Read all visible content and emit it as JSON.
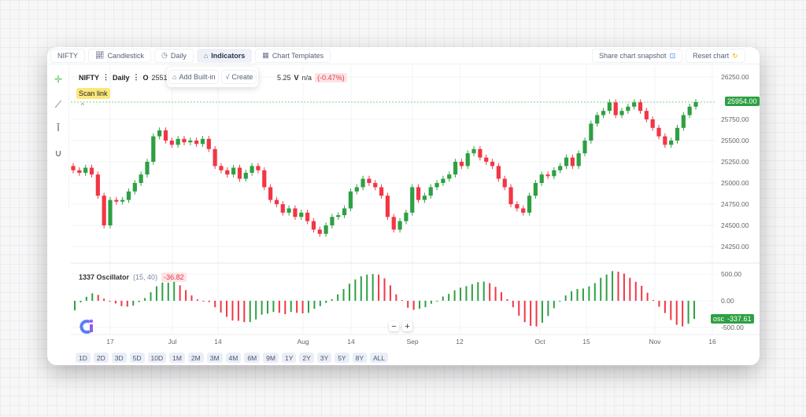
{
  "toolbar": {
    "symbol": "NIFTY",
    "chart_type": "Candlestick",
    "interval": "Daily",
    "indicators": "Indicators",
    "templates": "Chart Templates",
    "share": "Share chart snapshot",
    "reset": "Reset chart"
  },
  "indicator_menu": {
    "add_builtin": "Add Built-in",
    "create": "Create"
  },
  "legend": {
    "symbol": "NIFTY",
    "interval": "Daily",
    "open_label": "O",
    "open": "25511.65",
    "partial": "5.25",
    "volume_label": "V",
    "volume": "n/a",
    "change": "(-0.47%)"
  },
  "scan_link": "Scan link",
  "oscillator": {
    "name": "1337 Oscillator",
    "params": "(15, 40)",
    "value": "-36.82",
    "tag_label": "osc",
    "last_value": "-337.61"
  },
  "price_tag": "25954.00",
  "colors": {
    "up": "#2ea043",
    "down": "#f23645",
    "accent": "#2ea043"
  },
  "zoom": {
    "minus": "−",
    "plus": "+"
  },
  "ranges": [
    "1D",
    "2D",
    "3D",
    "5D",
    "10D",
    "1M",
    "2M",
    "3M",
    "4M",
    "6M",
    "9M",
    "1Y",
    "2Y",
    "3Y",
    "5Y",
    "8Y",
    "ALL"
  ],
  "chart_data": [
    {
      "type": "candlestick",
      "y_ticks": [
        "26250.00",
        "25750.00",
        "25500.00",
        "25250.00",
        "25000.00",
        "24750.00",
        "24500.00",
        "24250.00"
      ],
      "ylim": [
        24200,
        26300
      ],
      "x_ticks": [
        "17",
        "Jul",
        "14",
        "Aug",
        "14",
        "Sep",
        "12",
        "Oct",
        "15",
        "Nov",
        "16"
      ],
      "last_price": 25954.0,
      "candles": [
        [
          25200,
          25235,
          25115,
          25150
        ],
        [
          25150,
          25185,
          25085,
          25120
        ],
        [
          25120,
          25215,
          25085,
          25180
        ],
        [
          25180,
          25215,
          25065,
          25100
        ],
        [
          25100,
          25135,
          24815,
          24850
        ],
        [
          24850,
          24885,
          24465,
          24500
        ],
        [
          24500,
          24835,
          24465,
          24800
        ],
        [
          24800,
          24835,
          24745,
          24780
        ],
        [
          24780,
          24835,
          24745,
          24800
        ],
        [
          24800,
          24935,
          24765,
          24900
        ],
        [
          24900,
          25035,
          24865,
          25000
        ],
        [
          25000,
          25135,
          24965,
          25100
        ],
        [
          25100,
          25285,
          25065,
          25250
        ],
        [
          25250,
          25585,
          25215,
          25550
        ],
        [
          25550,
          25655,
          25515,
          25620
        ],
        [
          25620,
          25655,
          25465,
          25500
        ],
        [
          25500,
          25535,
          25415,
          25450
        ],
        [
          25450,
          25555,
          25415,
          25520
        ],
        [
          25520,
          25555,
          25445,
          25480
        ],
        [
          25480,
          25535,
          25445,
          25500
        ],
        [
          25500,
          25535,
          25425,
          25460
        ],
        [
          25460,
          25555,
          25425,
          25520
        ],
        [
          25520,
          25555,
          25365,
          25400
        ],
        [
          25400,
          25435,
          25165,
          25200
        ],
        [
          25200,
          25235,
          25115,
          25150
        ],
        [
          25150,
          25185,
          25065,
          25100
        ],
        [
          25100,
          25215,
          25065,
          25180
        ],
        [
          25180,
          25215,
          25015,
          25050
        ],
        [
          25050,
          25155,
          25015,
          25120
        ],
        [
          25120,
          25235,
          25085,
          25200
        ],
        [
          25200,
          25235,
          25115,
          25150
        ],
        [
          25150,
          25185,
          24915,
          24950
        ],
        [
          24950,
          24985,
          24765,
          24800
        ],
        [
          24800,
          24835,
          24715,
          24750
        ],
        [
          24750,
          24785,
          24615,
          24650
        ],
        [
          24650,
          24735,
          24615,
          24700
        ],
        [
          24700,
          24735,
          24565,
          24600
        ],
        [
          24600,
          24685,
          24565,
          24650
        ],
        [
          24650,
          24685,
          24515,
          24550
        ],
        [
          24550,
          24585,
          24415,
          24450
        ],
        [
          24450,
          24485,
          24365,
          24400
        ],
        [
          24400,
          24535,
          24365,
          24500
        ],
        [
          24500,
          24635,
          24465,
          24600
        ],
        [
          24600,
          24655,
          24565,
          24620
        ],
        [
          24620,
          24735,
          24585,
          24700
        ],
        [
          24700,
          24935,
          24665,
          24900
        ],
        [
          24900,
          24985,
          24865,
          24950
        ],
        [
          24950,
          25085,
          24915,
          25050
        ],
        [
          25050,
          25085,
          24965,
          25000
        ],
        [
          25000,
          25035,
          24915,
          24950
        ],
        [
          24950,
          24985,
          24815,
          24850
        ],
        [
          24850,
          24885,
          24565,
          24600
        ],
        [
          24600,
          24635,
          24415,
          24450
        ],
        [
          24450,
          24585,
          24415,
          24550
        ],
        [
          24550,
          24685,
          24515,
          24650
        ],
        [
          24650,
          24985,
          24615,
          24950
        ],
        [
          24950,
          24985,
          24765,
          24800
        ],
        [
          24800,
          24885,
          24765,
          24850
        ],
        [
          24850,
          24985,
          24815,
          24950
        ],
        [
          24950,
          25035,
          24915,
          25000
        ],
        [
          25000,
          25085,
          24965,
          25050
        ],
        [
          25050,
          25135,
          25015,
          25100
        ],
        [
          25100,
          25285,
          25065,
          25250
        ],
        [
          25250,
          25285,
          25165,
          25200
        ],
        [
          25200,
          25385,
          25165,
          25350
        ],
        [
          25350,
          25435,
          25315,
          25400
        ],
        [
          25400,
          25435,
          25265,
          25300
        ],
        [
          25300,
          25335,
          25215,
          25250
        ],
        [
          25250,
          25285,
          25165,
          25200
        ],
        [
          25200,
          25235,
          25015,
          25050
        ],
        [
          25050,
          25085,
          24915,
          24950
        ],
        [
          24950,
          24985,
          24715,
          24750
        ],
        [
          24750,
          24785,
          24665,
          24700
        ],
        [
          24700,
          24735,
          24615,
          24650
        ],
        [
          24650,
          24885,
          24615,
          24850
        ],
        [
          24850,
          25035,
          24815,
          25000
        ],
        [
          25000,
          25135,
          24965,
          25100
        ],
        [
          25100,
          25135,
          25045,
          25080
        ],
        [
          25080,
          25185,
          25045,
          25150
        ],
        [
          25150,
          25235,
          25115,
          25200
        ],
        [
          25200,
          25335,
          25165,
          25300
        ],
        [
          25300,
          25335,
          25165,
          25200
        ],
        [
          25200,
          25385,
          25165,
          25350
        ],
        [
          25350,
          25535,
          25315,
          25500
        ],
        [
          25500,
          25735,
          25465,
          25700
        ],
        [
          25700,
          25835,
          25665,
          25800
        ],
        [
          25800,
          25885,
          25765,
          25850
        ],
        [
          25850,
          25985,
          25815,
          25950
        ],
        [
          25950,
          25985,
          25765,
          25800
        ],
        [
          25800,
          25885,
          25765,
          25850
        ],
        [
          25850,
          25935,
          25815,
          25900
        ],
        [
          25900,
          25985,
          25865,
          25950
        ],
        [
          25950,
          25985,
          25815,
          25850
        ],
        [
          25850,
          25885,
          25715,
          25750
        ],
        [
          25750,
          25785,
          25615,
          25650
        ],
        [
          25650,
          25685,
          25515,
          25550
        ],
        [
          25550,
          25585,
          25415,
          25450
        ],
        [
          25450,
          25535,
          25415,
          25500
        ],
        [
          25500,
          25685,
          25465,
          25650
        ],
        [
          25650,
          25835,
          25615,
          25800
        ],
        [
          25800,
          25935,
          25765,
          25900
        ],
        [
          25900,
          25989,
          25865,
          25954
        ]
      ]
    },
    {
      "type": "bar",
      "name": "1337 Oscillator",
      "y_ticks": [
        "500.00",
        "0.00",
        "-500.00"
      ],
      "ylim": [
        -650,
        650
      ],
      "values": [
        -180,
        -30,
        75,
        140,
        110,
        40,
        0,
        -50,
        -100,
        -110,
        -90,
        -25,
        50,
        160,
        270,
        340,
        340,
        360,
        290,
        200,
        100,
        25,
        0,
        -25,
        -120,
        -220,
        -300,
        -370,
        -375,
        -400,
        -400,
        -350,
        -260,
        -240,
        -210,
        -225,
        -250,
        -210,
        -225,
        -235,
        -225,
        -150,
        -100,
        -40,
        30,
        120,
        220,
        320,
        400,
        460,
        490,
        500,
        490,
        420,
        290,
        120,
        15,
        -130,
        -170,
        -150,
        -120,
        -55,
        0,
        80,
        130,
        195,
        245,
        275,
        310,
        350,
        360,
        330,
        260,
        160,
        30,
        -120,
        -280,
        -400,
        -470,
        -480,
        -410,
        -285,
        -140,
        -10,
        100,
        180,
        220,
        230,
        270,
        330,
        430,
        490,
        555,
        545,
        510,
        430,
        355,
        280,
        150,
        15,
        -110,
        -230,
        -360,
        -450,
        -480,
        -430,
        -340
      ]
    }
  ]
}
